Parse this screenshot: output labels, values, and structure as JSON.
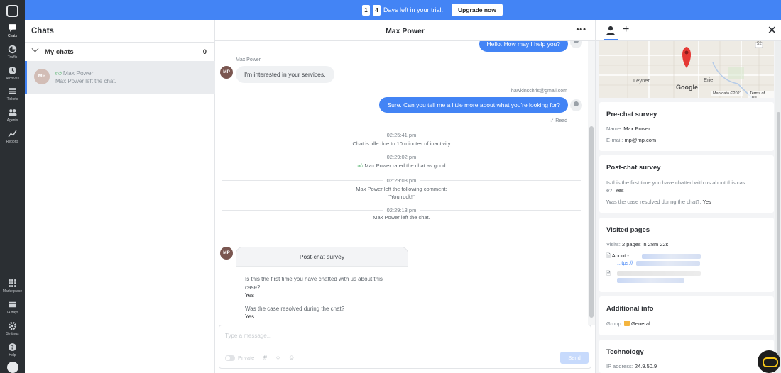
{
  "rail": {
    "items": [
      {
        "label": "Chats",
        "icon": "chat-bubble-icon"
      },
      {
        "label": "Traffic",
        "icon": "traffic-icon"
      },
      {
        "label": "Archives",
        "icon": "clock-icon"
      },
      {
        "label": "Tickets",
        "icon": "ticket-icon"
      },
      {
        "label": "Agents",
        "icon": "people-icon"
      },
      {
        "label": "Reports",
        "icon": "chart-line-icon"
      }
    ],
    "bottom": [
      {
        "label": "Marketplace",
        "icon": "grid-icon"
      },
      {
        "label": "14 days",
        "icon": "card-icon"
      },
      {
        "label": "Settings",
        "icon": "gear-icon"
      },
      {
        "label": "Help",
        "icon": "help-icon"
      }
    ]
  },
  "banner": {
    "digit1": "1",
    "digit2": "4",
    "text": "Days left in your trial.",
    "upgrade": "Upgrade now",
    "color": "#4384f5"
  },
  "chats": {
    "title": "Chats",
    "section": "My chats",
    "count": "0",
    "item": {
      "initials": "MP",
      "name": "Max Power",
      "preview": "Max Power left the chat."
    }
  },
  "conversation": {
    "title": "Max Power",
    "menu": "•••",
    "msg_agent_1": "Hello. How may I help you?",
    "visitor_name": "Max Power",
    "visitor_initials": "MP",
    "msg_visitor_1": "I'm interested in your services.",
    "agent_email": "hawkinschris@gmail.com",
    "msg_agent_2": "Sure. Can you tell me a little more about what you're looking for?",
    "read": "✓ Read",
    "events": [
      {
        "time": "02:25:41 pm",
        "text": "Chat is idle due to 10 minutes of inactivity"
      },
      {
        "time": "02:29:02 pm",
        "text": "Max Power rated the chat as good"
      },
      {
        "time": "02:29:08 pm",
        "text": "Max Power left the following comment:",
        "text2": "\"You rock!\""
      },
      {
        "time": "02:29:13 pm",
        "text": "Max Power left the chat."
      }
    ],
    "survey": {
      "title": "Post-chat survey",
      "q1": "Is this the first time you have chatted with us about this case?",
      "a1": "Yes",
      "q2": "Was the case resolved during the chat?",
      "a2": "Yes"
    }
  },
  "composer": {
    "placeholder": "Type a message...",
    "private": "Private",
    "send": "Send"
  },
  "details": {
    "map": {
      "label_leyner": "Leyner",
      "label_erie": "Erie",
      "label_google": "Google",
      "credits": "Map data ©2021",
      "terms": "Terms of Use",
      "route": "52"
    },
    "prechat": {
      "title": "Pre-chat survey",
      "name_label": "Name:",
      "name_value": "Max Power",
      "email_label": "E-mail:",
      "email_value": "mp@mp.com"
    },
    "postchat": {
      "title": "Post-chat survey",
      "q1": "Is this the first time you have chatted with us about this cas",
      "q1b": "e?:",
      "a1": "Yes",
      "q2": "Was the case resolved during the chat?:",
      "a2": "Yes"
    },
    "visited": {
      "title": "Visited pages",
      "visits_label": "Visits:",
      "visits_value": "2 pages in 28m 22s",
      "page1": "About -",
      "page1_url": "...tps://"
    },
    "additional": {
      "title": "Additional info",
      "group_label": "Group:",
      "group_value": "General"
    },
    "technology": {
      "title": "Technology",
      "ip_label": "IP address:",
      "ip_value": "24.9.50.9"
    }
  }
}
